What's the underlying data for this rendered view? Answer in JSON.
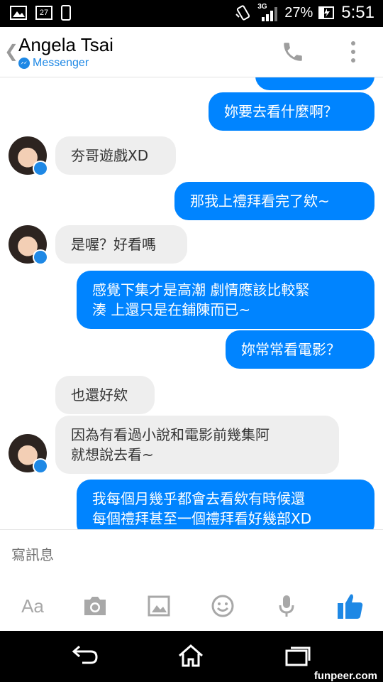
{
  "status_bar": {
    "network": "3G",
    "battery": "27%",
    "time": "5:51",
    "notification_badge": "27"
  },
  "header": {
    "back_icon": "chevron-left-icon",
    "contact_name": "Angela Tsai",
    "app_label": "Messenger",
    "call_icon": "phone-icon",
    "menu_icon": "more-vertical-icon"
  },
  "messages": [
    {
      "from": "me",
      "text": "妳要去看什麼啊？"
    },
    {
      "from": "them",
      "text": "夯哥遊戲XD"
    },
    {
      "from": "me",
      "text": "那我上禮拜看完了欸~"
    },
    {
      "from": "them",
      "text": "是喔？好看嗎"
    },
    {
      "from": "me",
      "text": "感覺下集才是高潮 劇情應該比較緊\n湊 上還只是在鋪陳而已~"
    },
    {
      "from": "me",
      "text": "妳常常看電影？"
    },
    {
      "from": "them",
      "text": "也還好欸"
    },
    {
      "from": "them",
      "text": "因為有看過小說和電影前幾集阿\n就想說去看~"
    },
    {
      "from": "me",
      "text": "我每個月幾乎都會去看欸有時候還\n每個禮拜甚至一個禮拜看好幾部XD"
    }
  ],
  "composer": {
    "placeholder": "寫訊息"
  },
  "toolbar": {
    "text_label": "Aa",
    "icons": [
      "camera-icon",
      "gallery-icon",
      "emoji-icon",
      "microphone-icon",
      "thumbs-up-icon"
    ]
  },
  "watermark": "funpeer.com",
  "colors": {
    "accent": "#0084ff",
    "incoming": "#eeeeee",
    "messenger_blue": "#1e88e5"
  }
}
